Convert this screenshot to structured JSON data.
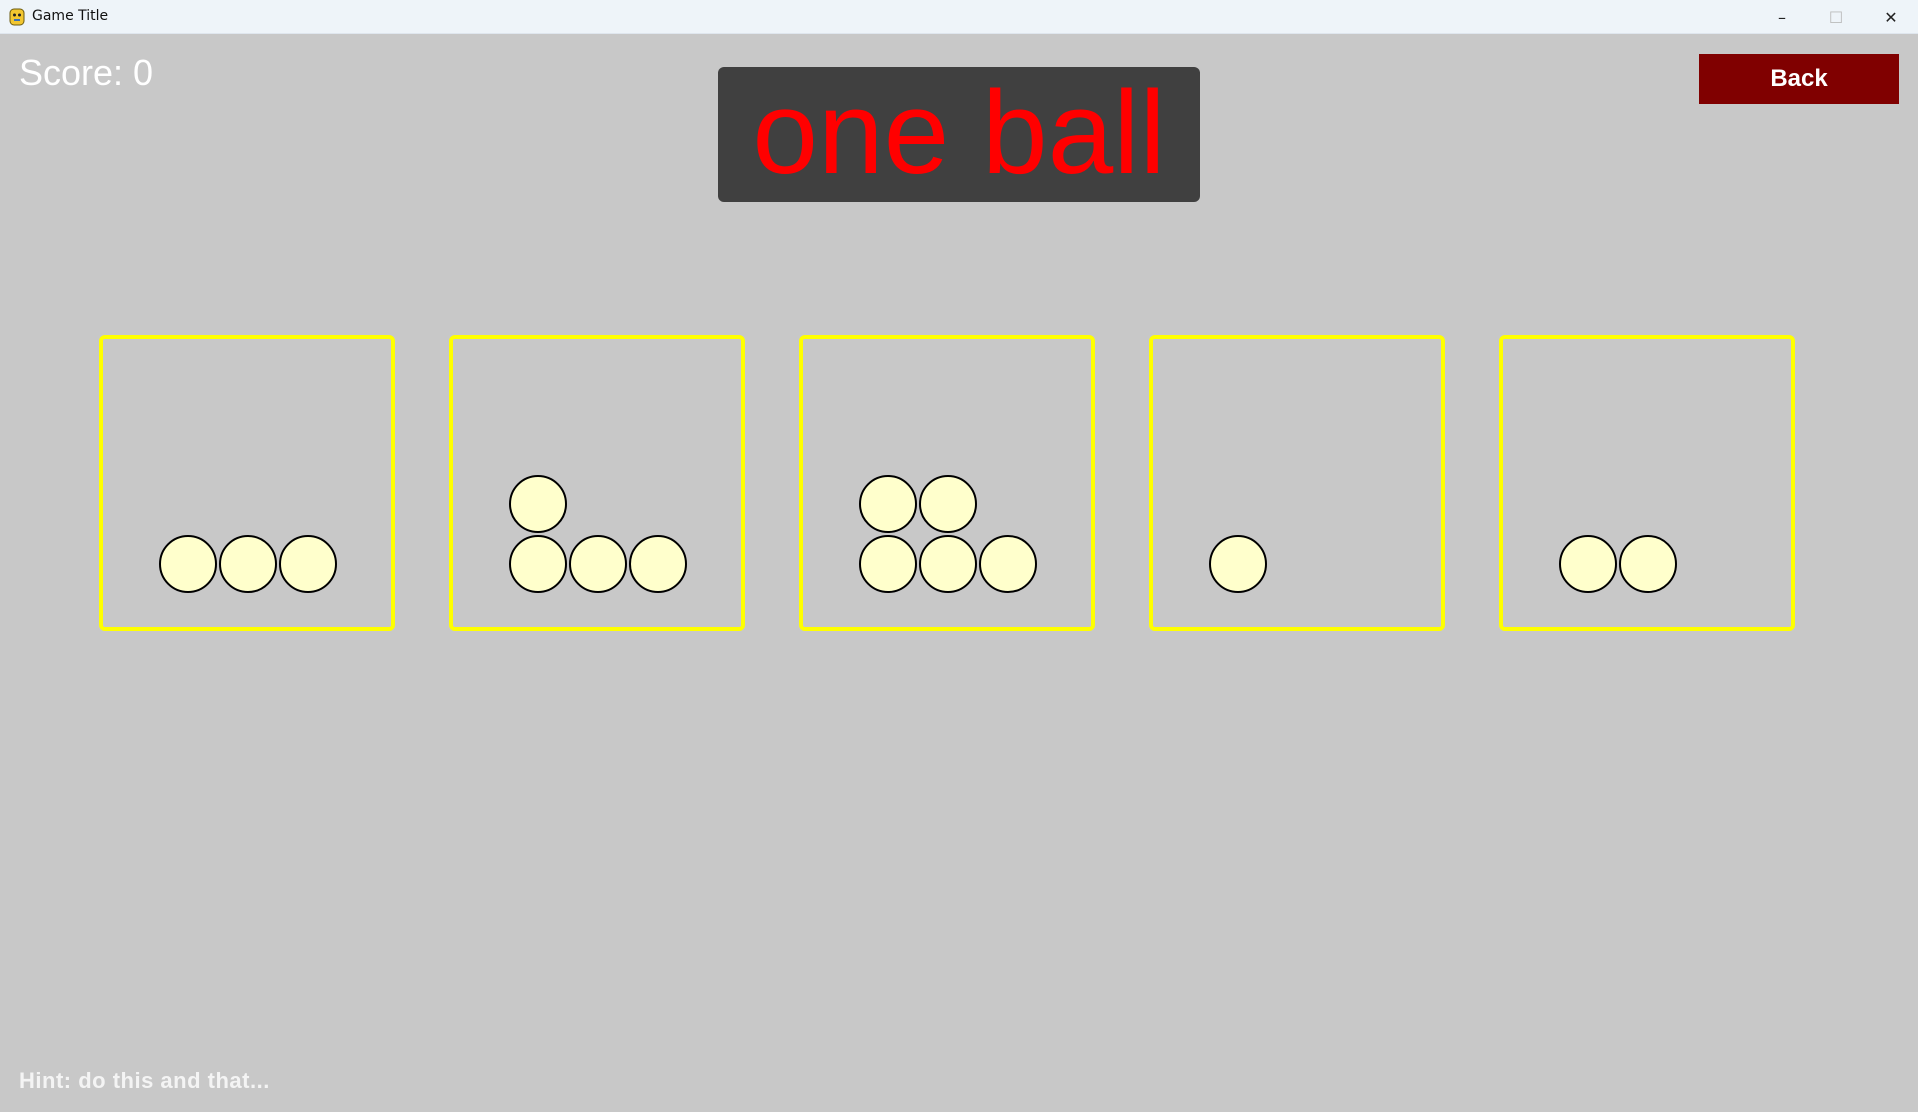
{
  "window": {
    "title": "Game Title",
    "icon": "python-icon",
    "minimize_glyph": "–",
    "maximize_glyph": "☐",
    "close_glyph": "✕"
  },
  "game": {
    "score_text": "Score: 0",
    "back_label": "Back",
    "prompt": "one ball",
    "hint": "Hint: do this and that...",
    "colors": {
      "background": "#c8c8c8",
      "prompt_text": "#ff0000",
      "prompt_panel": "#404040",
      "back_button": "#800000",
      "box_border": "#ffff00",
      "ball_fill": "#ffffcc"
    },
    "boxes": [
      {
        "ball_count": 3
      },
      {
        "ball_count": 4
      },
      {
        "ball_count": 5
      },
      {
        "ball_count": 1
      },
      {
        "ball_count": 2
      }
    ]
  }
}
